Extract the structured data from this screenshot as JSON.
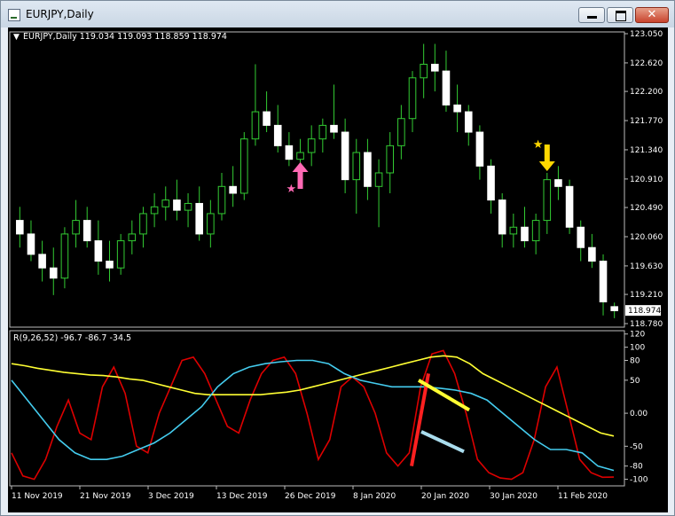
{
  "window": {
    "title": "EURJPY,Daily",
    "minimize_icon": "minimize-icon",
    "maximize_icon": "maximize-icon",
    "close_icon": "close-icon"
  },
  "price_panel": {
    "header": "EURJPY,Daily  119.034 119.093 118.859 118.974",
    "axis_labels": [
      "123.050",
      "122.620",
      "122.200",
      "121.770",
      "121.340",
      "120.910",
      "120.490",
      "120.060",
      "119.630",
      "119.210",
      "118.780"
    ],
    "current_price": "118.974"
  },
  "indicator_panel": {
    "header": "R(9,26,52) -96.7 -86.7 -34.5",
    "axis_labels": [
      "120",
      "100",
      "80",
      "50",
      "0.00",
      "-50",
      "-80",
      "-100"
    ]
  },
  "date_labels": [
    "11 Nov 2019",
    "21 Nov 2019",
    "3 Dec 2019",
    "13 Dec 2019",
    "26 Dec 2019",
    "8 Jan 2020",
    "20 Jan 2020",
    "30 Jan 2020",
    "11 Feb 2020"
  ],
  "colors": {
    "background": "#000000",
    "candle_up": "#ffffff",
    "wick": "#33cc33",
    "red_line": "#dd0000",
    "yellow_line": "#ffff33",
    "cyan_line": "#44ccee",
    "buy_arrow": "#ff69b4",
    "sell_arrow": "#ffd700"
  },
  "chart_data": {
    "type": "candlestick",
    "symbol": "EURJPY",
    "timeframe": "Daily",
    "ohlc_last": {
      "open": 119.034,
      "high": 119.093,
      "low": 118.859,
      "close": 118.974
    },
    "candles": [
      [
        120.3,
        120.5,
        119.9,
        120.1
      ],
      [
        120.1,
        120.3,
        119.7,
        119.8
      ],
      [
        119.8,
        120.0,
        119.4,
        119.6
      ],
      [
        119.6,
        119.9,
        119.2,
        119.45
      ],
      [
        119.45,
        120.2,
        119.3,
        120.1
      ],
      [
        120.1,
        120.6,
        119.9,
        120.3
      ],
      [
        120.3,
        120.5,
        119.9,
        120.0
      ],
      [
        120.0,
        120.3,
        119.5,
        119.7
      ],
      [
        119.7,
        120.0,
        119.4,
        119.6
      ],
      [
        119.6,
        120.1,
        119.5,
        120.0
      ],
      [
        120.0,
        120.3,
        119.8,
        120.1
      ],
      [
        120.1,
        120.5,
        119.9,
        120.4
      ],
      [
        120.4,
        120.7,
        120.2,
        120.5
      ],
      [
        120.5,
        120.8,
        120.3,
        120.6
      ],
      [
        120.6,
        120.9,
        120.3,
        120.45
      ],
      [
        120.45,
        120.7,
        120.2,
        120.55
      ],
      [
        120.55,
        120.8,
        120.0,
        120.1
      ],
      [
        120.1,
        120.6,
        119.9,
        120.4
      ],
      [
        120.4,
        121.0,
        120.3,
        120.8
      ],
      [
        120.8,
        121.1,
        120.5,
        120.7
      ],
      [
        120.7,
        121.6,
        120.6,
        121.5
      ],
      [
        121.5,
        122.6,
        121.4,
        121.9
      ],
      [
        121.9,
        122.2,
        121.6,
        121.7
      ],
      [
        121.7,
        122.0,
        121.3,
        121.4
      ],
      [
        121.4,
        121.6,
        121.1,
        121.2
      ],
      [
        121.2,
        121.5,
        121.0,
        121.3
      ],
      [
        121.3,
        121.7,
        121.1,
        121.5
      ],
      [
        121.5,
        121.8,
        121.3,
        121.7
      ],
      [
        121.7,
        122.3,
        121.5,
        121.6
      ],
      [
        121.6,
        121.8,
        120.7,
        120.9
      ],
      [
        120.9,
        121.5,
        120.4,
        121.3
      ],
      [
        121.3,
        121.5,
        120.6,
        120.8
      ],
      [
        120.8,
        121.2,
        120.2,
        121.0
      ],
      [
        121.0,
        121.6,
        120.7,
        121.4
      ],
      [
        121.4,
        122.0,
        121.2,
        121.8
      ],
      [
        121.8,
        122.5,
        121.6,
        122.4
      ],
      [
        122.4,
        122.9,
        122.1,
        122.6
      ],
      [
        122.6,
        122.9,
        122.2,
        122.5
      ],
      [
        122.5,
        122.8,
        121.9,
        122.0
      ],
      [
        122.0,
        122.3,
        121.6,
        121.9
      ],
      [
        121.9,
        122.0,
        121.4,
        121.6
      ],
      [
        121.6,
        121.7,
        120.9,
        121.1
      ],
      [
        121.1,
        121.2,
        120.4,
        120.6
      ],
      [
        120.6,
        120.7,
        119.9,
        120.1
      ],
      [
        120.1,
        120.4,
        119.9,
        120.2
      ],
      [
        120.2,
        120.5,
        119.9,
        120.0
      ],
      [
        120.0,
        120.4,
        119.8,
        120.3
      ],
      [
        120.3,
        121.0,
        120.1,
        120.9
      ],
      [
        120.9,
        121.1,
        120.6,
        120.8
      ],
      [
        120.8,
        120.9,
        120.1,
        120.2
      ],
      [
        120.2,
        120.3,
        119.7,
        119.9
      ],
      [
        119.9,
        120.1,
        119.6,
        119.7
      ],
      [
        119.7,
        119.8,
        118.9,
        119.1
      ],
      [
        119.03,
        119.09,
        118.86,
        118.97
      ]
    ],
    "signals": [
      {
        "type": "buy",
        "index": 25
      },
      {
        "type": "sell",
        "index": 47
      }
    ],
    "indicator": {
      "name": "R(9,26,52)",
      "last_values": [
        -96.7,
        -86.7,
        -34.5
      ],
      "ylim": [
        -110,
        125
      ],
      "series": [
        {
          "color": "red",
          "values": [
            -60,
            -95,
            -100,
            -70,
            -20,
            20,
            -30,
            -40,
            40,
            70,
            30,
            -50,
            -60,
            0,
            40,
            80,
            85,
            60,
            20,
            -20,
            -30,
            20,
            60,
            80,
            85,
            60,
            0,
            -70,
            -40,
            40,
            55,
            40,
            0,
            -60,
            -80,
            -60,
            40,
            90,
            95,
            60,
            0,
            -70,
            -90,
            -98,
            -100,
            -90,
            -40,
            40,
            70,
            0,
            -70,
            -90,
            -97,
            -96.7
          ]
        },
        {
          "color": "yellow",
          "values": [
            75,
            72,
            68,
            65,
            62,
            60,
            58,
            57,
            55,
            52,
            50,
            45,
            40,
            35,
            30,
            28,
            28,
            28,
            28,
            28,
            30,
            32,
            35,
            40,
            45,
            50,
            55,
            60,
            65,
            70,
            75,
            80,
            85,
            87,
            85,
            75,
            60,
            50,
            40,
            30,
            20,
            10,
            0,
            -10,
            -20,
            -30,
            -34.5
          ]
        },
        {
          "color": "cyan",
          "values": [
            50,
            20,
            -10,
            -40,
            -60,
            -70,
            -70,
            -65,
            -55,
            -45,
            -30,
            -10,
            10,
            40,
            60,
            70,
            75,
            78,
            80,
            80,
            75,
            60,
            50,
            45,
            40,
            40,
            40,
            38,
            35,
            30,
            20,
            0,
            -20,
            -40,
            -55,
            -55,
            -60,
            -80,
            -86.7
          ]
        }
      ]
    }
  }
}
